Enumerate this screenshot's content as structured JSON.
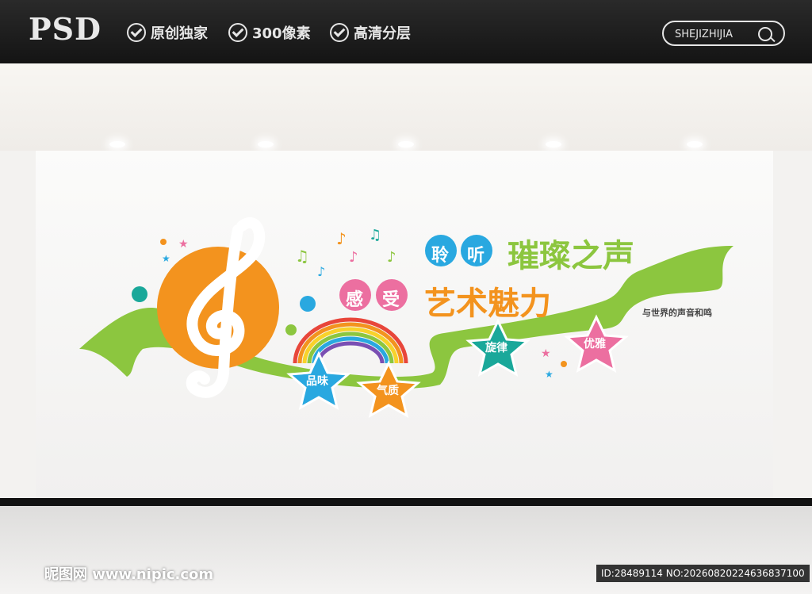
{
  "header": {
    "logo": "PSD",
    "features": [
      "原创独家",
      "300像素",
      "高清分层"
    ],
    "search_label": "SHEJIZHIJIA"
  },
  "wall": {
    "title_line1_circles": [
      "聆",
      "听"
    ],
    "title_line1_text": "璀璨之声",
    "title_line2_circles": [
      "感",
      "受"
    ],
    "title_line2_text": "艺术魅力",
    "subtitle": "与世界的声音和鸣",
    "stars": [
      "品味",
      "气质",
      "旋律",
      "优雅"
    ]
  },
  "footer": {
    "watermark": "昵图网 www.nipic.com",
    "id_text": "ID:28489114 NO:20260820224636837100"
  },
  "colors": {
    "orange": "#f3931e",
    "green": "#8cc63f",
    "blue": "#29a8e0",
    "pink": "#ec6fa0",
    "teal": "#1aa89a"
  }
}
